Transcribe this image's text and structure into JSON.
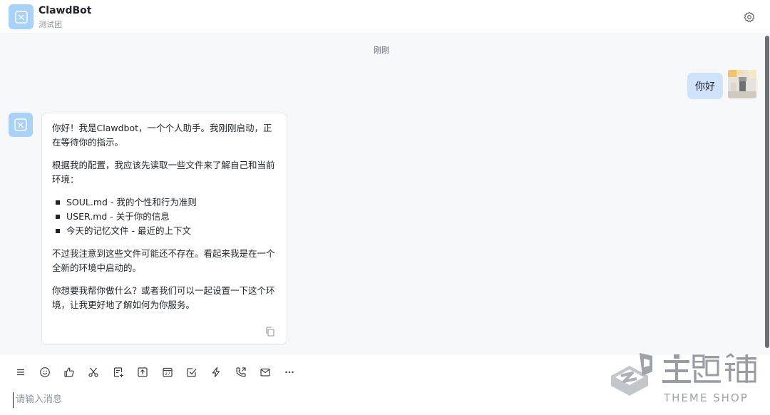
{
  "header": {
    "title": "ClawdBot",
    "subtitle": "测试团",
    "settings_icon": "gear-icon"
  },
  "chat": {
    "timestamp": "刚刚",
    "user_message": "你好",
    "bot_message": {
      "p1": "你好！我是Clawdbot，一个个人助手。我刚刚启动，正在等待你的指示。",
      "p2": "根据我的配置，我应该先读取一些文件来了解自己和当前环境：",
      "list": [
        "SOUL.md - 我的个性和行为准则",
        "USER.md - 关于你的信息",
        "今天的记忆文件 - 最近的上下文"
      ],
      "p3": "不过我注意到这些文件可能还不存在。看起来我是在一个全新的环境中启动的。",
      "p4": "你想要我帮你做什么？或者我们可以一起设置一下这个环境，让我更好地了解如何为你服务。"
    }
  },
  "toolbar": {
    "icons": [
      "menu-icon",
      "emoji-icon",
      "thumbs-up-icon",
      "scissors-icon",
      "doc-add-icon",
      "upload-icon",
      "calendar-icon",
      "task-check-icon",
      "lightning-icon",
      "phone-call-icon",
      "mail-icon",
      "more-icon"
    ],
    "calendar_day": "27"
  },
  "input": {
    "placeholder": "请输入消息",
    "value": ""
  },
  "watermark": {
    "brand_cn": "主题铺",
    "brand_en": "THEME SHOP"
  },
  "colors": {
    "bot_avatar": "#a9d2fb",
    "user_bubble": "#cfe4fb",
    "chat_background": "#f7f8fa",
    "watermark": "#9a9ea5"
  }
}
